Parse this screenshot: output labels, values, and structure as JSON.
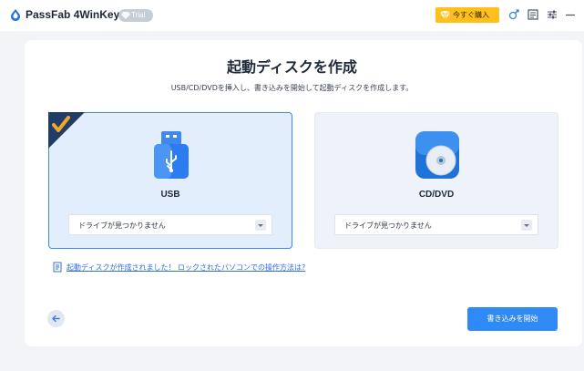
{
  "titlebar": {
    "app_name": "PassFab 4WinKey",
    "trial_badge": "Trial",
    "buy_label": "今すぐ購入"
  },
  "main": {
    "title": "起動ディスクを作成",
    "subtitle": "USB/CD/DVDを挿入し、書き込みを開始して起動ディスクを作成します。"
  },
  "options": [
    {
      "label": "USB",
      "dropdown_value": "ドライブが見つかりません",
      "selected": true,
      "icon": "usb-drive-icon"
    },
    {
      "label": "CD/DVD",
      "dropdown_value": "ドライブが見つかりません",
      "selected": false,
      "icon": "cd-dvd-icon"
    }
  ],
  "help_link": "起動ディスクが作成されました！ ロックされたパソコンでの操作方法は?",
  "buttons": {
    "start": "書き込みを開始"
  },
  "colors": {
    "accent": "#2f8af5",
    "buy": "#ffbf1c",
    "selected_border": "#3a8cf0",
    "corner_badge": "#1f3d68"
  }
}
